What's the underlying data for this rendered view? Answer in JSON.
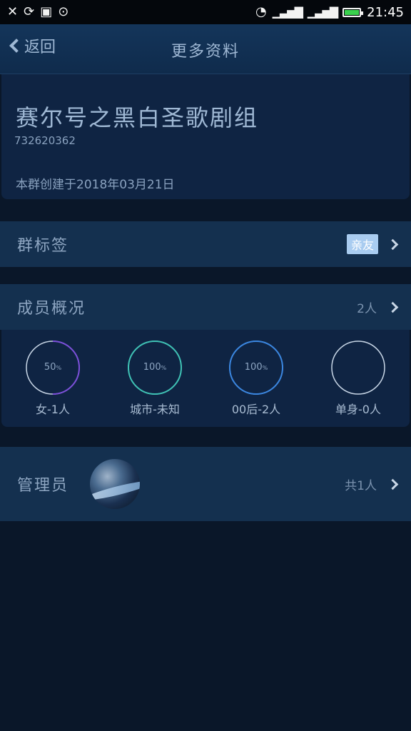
{
  "status_bar": {
    "left_icons": [
      "missed-call-icon",
      "sync-icon",
      "image-icon",
      "more-icon"
    ],
    "time": "21:45",
    "battery_color": "#3ad14e"
  },
  "header": {
    "back_label": "返回",
    "title": "更多资料"
  },
  "group_info": {
    "name": "赛尔号之黑白圣歌剧组",
    "id": "732620362",
    "created": "本群创建于2018年03月21日"
  },
  "tags_row": {
    "label": "群标签",
    "tag": "亲友"
  },
  "members_row": {
    "label": "成员概况",
    "count": "2人"
  },
  "stats": [
    {
      "value": "50",
      "unit": "%",
      "label": "女-1人",
      "percent": 50,
      "color": "#7b4fd9"
    },
    {
      "value": "100",
      "unit": "%",
      "label": "城市-未知",
      "percent": 100,
      "color": "#3ec1b4"
    },
    {
      "value": "100",
      "unit": "%",
      "label": "00后-2人",
      "percent": 100,
      "color": "#3a86e0"
    },
    {
      "value": "",
      "unit": "",
      "label": "单身-0人",
      "percent": 0,
      "color": "#c8d6e6"
    }
  ],
  "admin_row": {
    "label": "管理员",
    "count": "共1人"
  }
}
